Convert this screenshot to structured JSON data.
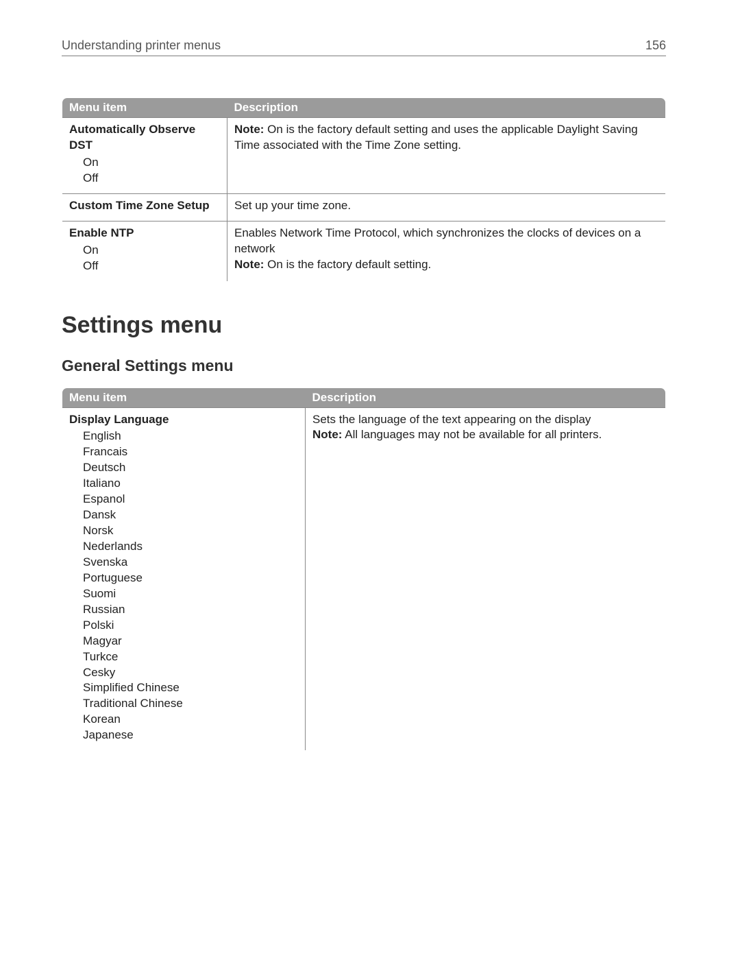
{
  "header": {
    "title": "Understanding printer menus",
    "page": "156"
  },
  "table1": {
    "cols": [
      "Menu item",
      "Description"
    ],
    "rows": [
      {
        "title": "Automatically Observe DST",
        "options": [
          "On",
          "Off"
        ],
        "desc_note_label": "Note:",
        "desc_note": " On is the factory default setting and uses the applicable Daylight Saving Time associated with the Time Zone setting."
      },
      {
        "title": "Custom Time Zone Setup",
        "options": [],
        "desc": "Set up your time zone."
      },
      {
        "title": "Enable NTP",
        "options": [
          "On",
          "Off"
        ],
        "desc": "Enables Network Time Protocol, which synchronizes the clocks of devices on a network",
        "desc_note_label": "Note:",
        "desc_note": " On is the factory default setting."
      }
    ]
  },
  "section_title": "Settings menu",
  "subsection_title": "General Settings menu",
  "table2": {
    "cols": [
      "Menu item",
      "Description"
    ],
    "row": {
      "title": "Display Language",
      "options": [
        "English",
        "Francais",
        "Deutsch",
        "Italiano",
        "Espanol",
        "Dansk",
        "Norsk",
        "Nederlands",
        "Svenska",
        "Portuguese",
        "Suomi",
        "Russian",
        "Polski",
        "Magyar",
        "Turkce",
        "Cesky",
        "Simplified Chinese",
        "Traditional Chinese",
        "Korean",
        "Japanese"
      ],
      "desc": "Sets the language of the text appearing on the display",
      "desc_note_label": "Note:",
      "desc_note": " All languages may not be available for all printers."
    }
  }
}
